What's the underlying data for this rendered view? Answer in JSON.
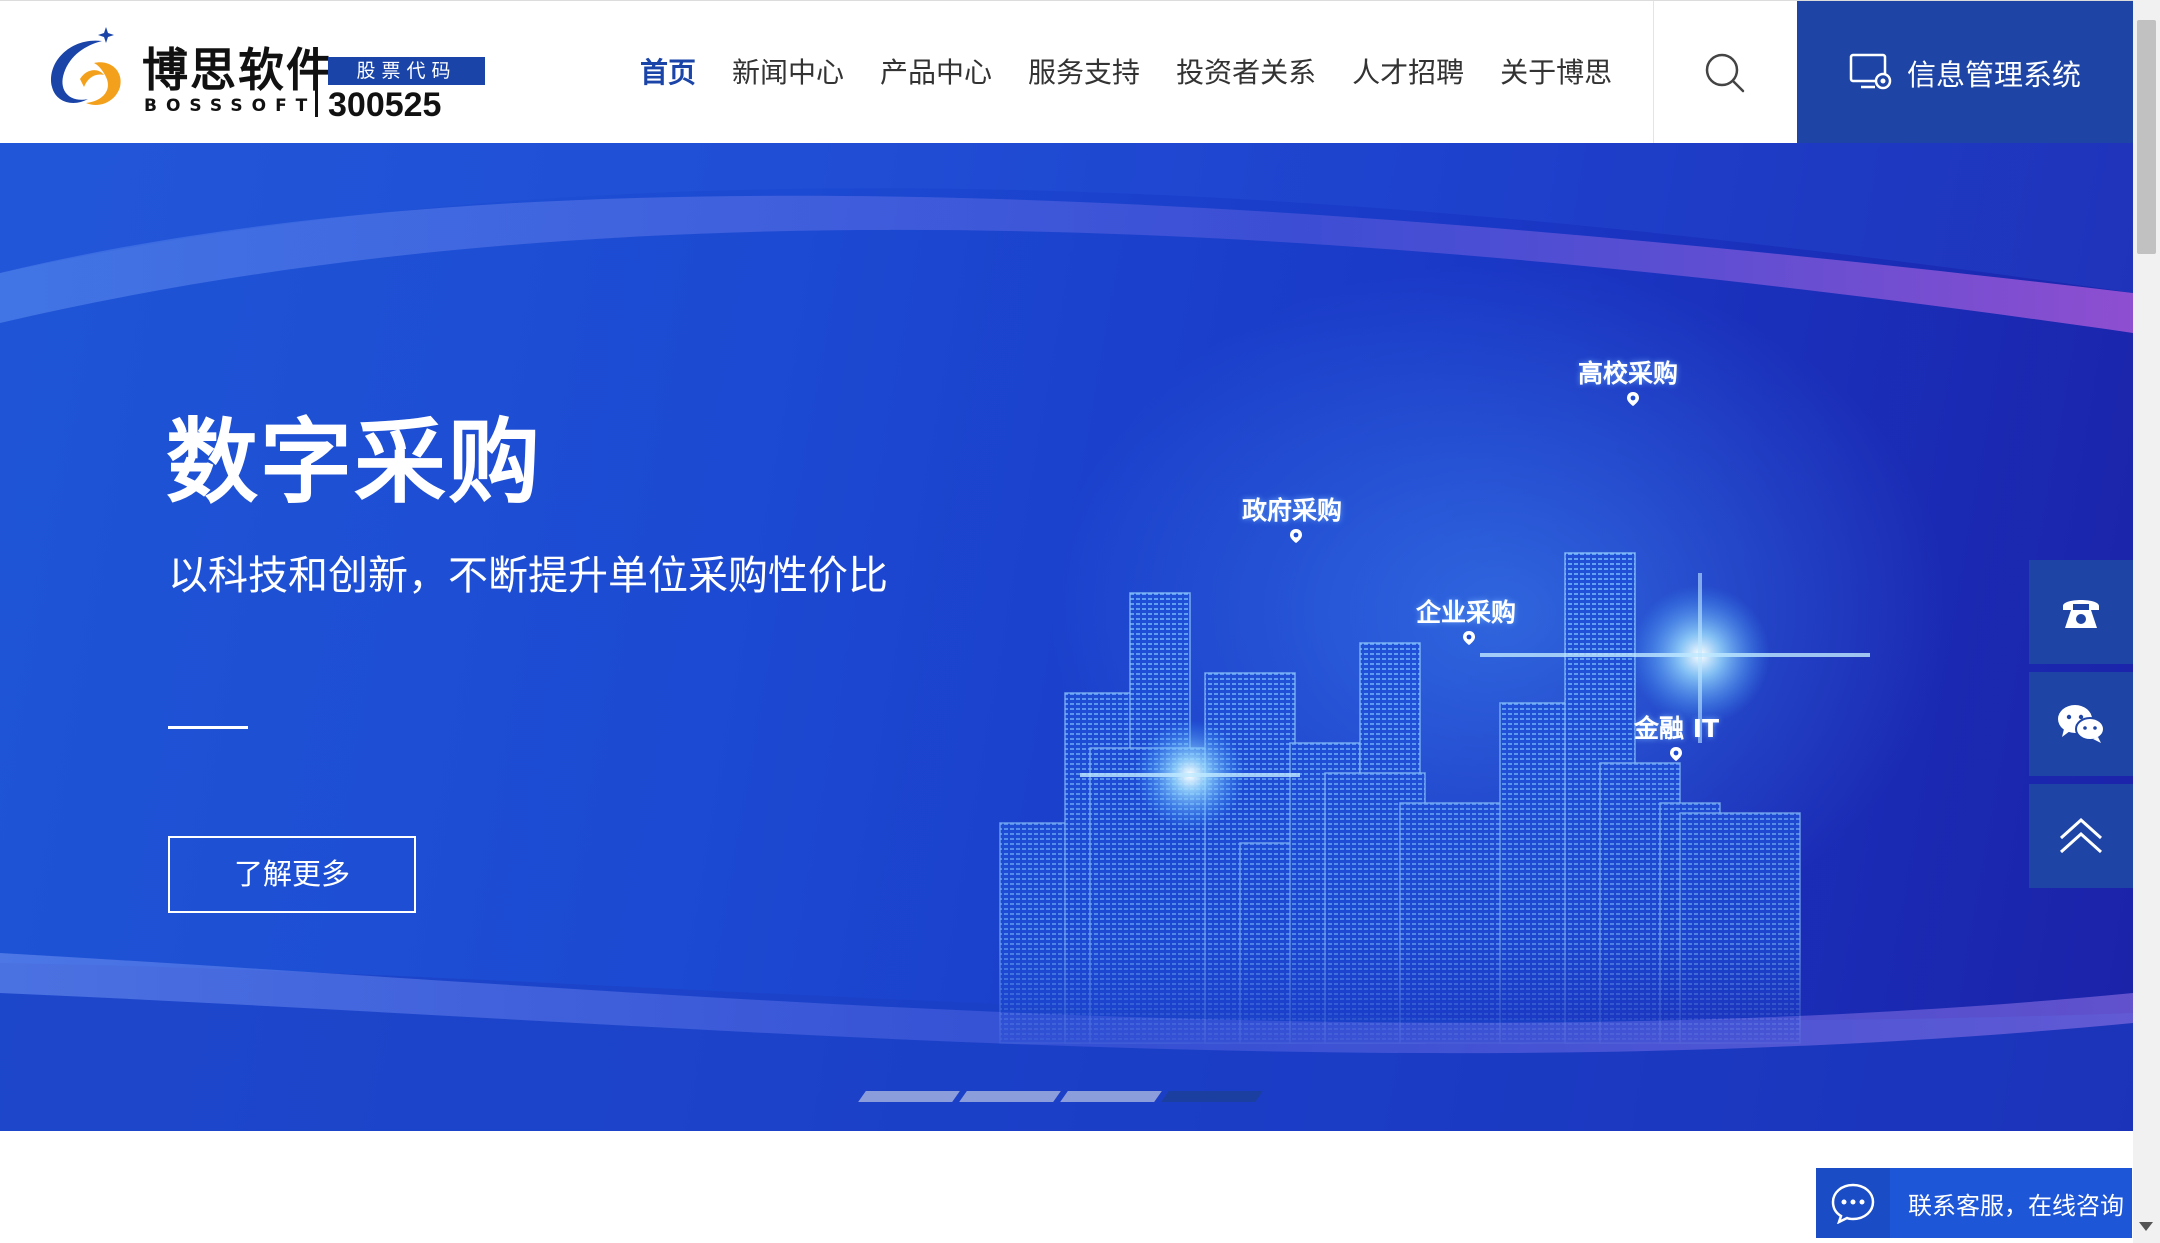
{
  "header": {
    "logo": {
      "name_cn": "博思软件",
      "name_en": "BOSSSOFT",
      "stock_label": "股票代码",
      "stock_code": "300525"
    },
    "nav": [
      {
        "label": "首页",
        "active": true
      },
      {
        "label": "新闻中心",
        "active": false
      },
      {
        "label": "产品中心",
        "active": false
      },
      {
        "label": "服务支持",
        "active": false
      },
      {
        "label": "投资者关系",
        "active": false
      },
      {
        "label": "人才招聘",
        "active": false
      },
      {
        "label": "关于博思",
        "active": false
      }
    ],
    "search_icon": "search-icon",
    "info_system_label": "信息管理系统",
    "info_system_icon": "monitor-gear-icon"
  },
  "banner": {
    "title": "数字采购",
    "subtitle": "以科技和创新，不断提升单位采购性价比",
    "button_label": "了解更多",
    "city_labels": [
      "高校采购",
      "政府采购",
      "企业采购",
      "金融 IT"
    ],
    "slides_total": 4,
    "active_slide": 4
  },
  "side_tools": [
    {
      "icon": "telephone-icon"
    },
    {
      "icon": "wechat-icon"
    },
    {
      "icon": "back-to-top-icon"
    }
  ],
  "chat": {
    "label": "联系客服，在线咨询",
    "icon": "chat-bubble-icon"
  },
  "colors": {
    "brand_blue": "#1e45a6",
    "nav_active": "#1a44a8",
    "banner_blue": "#1c4ad2",
    "chat_blue": "#1e56d8"
  }
}
